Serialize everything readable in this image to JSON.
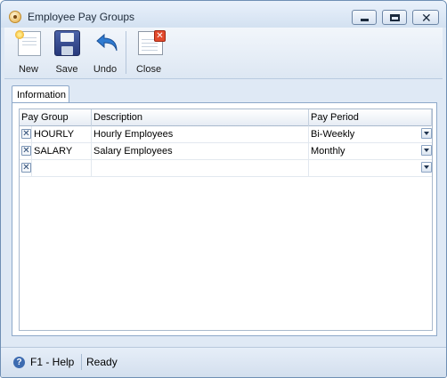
{
  "window": {
    "title": "Employee Pay Groups",
    "icon": "app-icon"
  },
  "toolbar": {
    "new_label": "New",
    "save_label": "Save",
    "undo_label": "Undo",
    "close_label": "Close"
  },
  "tabs": [
    {
      "label": "Information",
      "active": true
    }
  ],
  "grid": {
    "columns": [
      "Pay Group",
      "Description",
      "Pay Period"
    ],
    "rows": [
      {
        "pay_group": "HOURLY",
        "description": "Hourly Employees",
        "pay_period": "Bi-Weekly"
      },
      {
        "pay_group": "SALARY",
        "description": "Salary Employees",
        "pay_period": "Monthly"
      },
      {
        "pay_group": "",
        "description": "",
        "pay_period": ""
      }
    ]
  },
  "statusbar": {
    "help": "F1 - Help",
    "status": "Ready"
  }
}
